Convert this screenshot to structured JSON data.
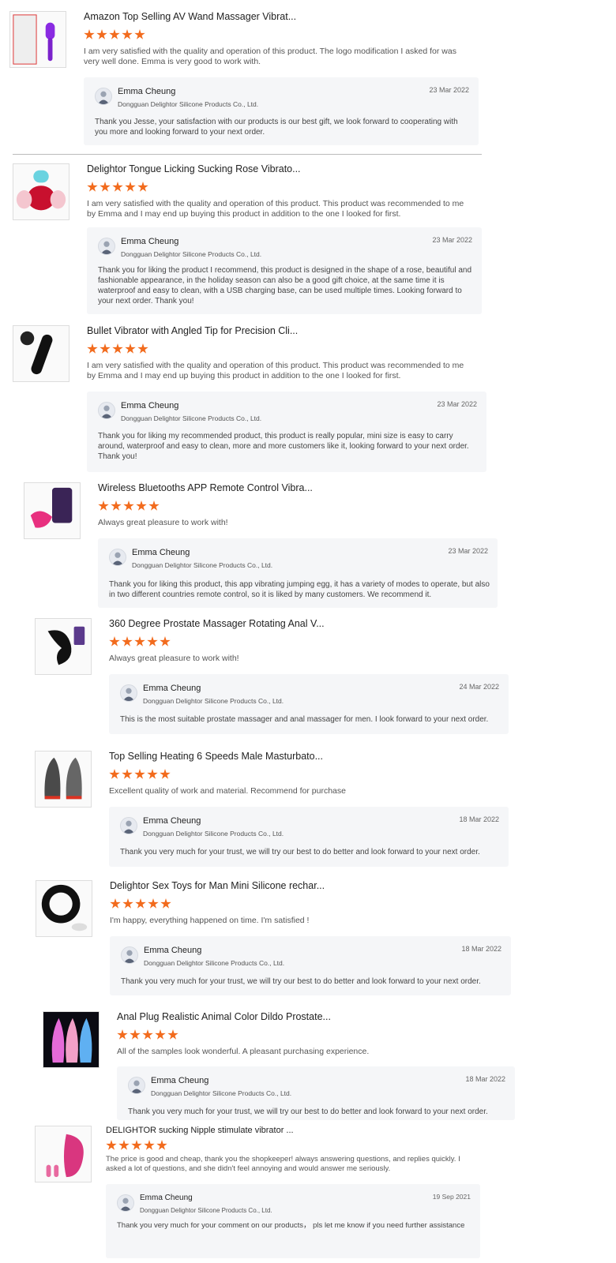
{
  "reviews": [
    {
      "title": "Amazon Top Selling AV Wand Massager Vibrat...",
      "text": "I am very satisfied with the quality and operation of this product. The logo modification I asked for was very well done.  Emma is very good to work with.",
      "rating": 5,
      "reply": {
        "name": "Emma Cheung",
        "company": "Dongguan Delightor Silicone Products Co., Ltd.",
        "date": "23 Mar 2022",
        "text": "Thank you Jesse, your satisfaction with our products is our best gift, we look forward to cooperating with you more and looking forward to your next order."
      }
    },
    {
      "title": "Delightor Tongue Licking Sucking Rose Vibrato...",
      "text": "I am very satisfied with the quality and operation of this product. This product was recommended to me by Emma and I may end up buying this product in addition to the one I looked for first.",
      "rating": 5,
      "reply": {
        "name": "Emma Cheung",
        "company": "Dongguan Delightor Silicone Products Co., Ltd.",
        "date": "23 Mar 2022",
        "text": "Thank you for liking the product I recommend, this product is designed in the shape of a rose, beautiful and fashionable appearance, in the holiday season can also be a good gift choice, at the same time it is waterproof and easy to clean, with a USB charging base, can be used multiple times. Looking forward to your next order. Thank you!"
      }
    },
    {
      "title": "Bullet Vibrator with Angled Tip for Precision Cli...",
      "text": "I am very satisfied with the quality and operation of this product. This product was recommended to me by Emma and I may end up buying this product in addition to the one I looked for first.",
      "rating": 5,
      "reply": {
        "name": "Emma Cheung",
        "company": "Dongguan Delightor Silicone Products Co., Ltd.",
        "date": "23 Mar 2022",
        "text": "Thank you for liking my recommended product, this product is really popular, mini size is easy to carry around, waterproof and easy to clean, more and more customers like it, looking forward to your next order. Thank you!"
      }
    },
    {
      "title": "Wireless Bluetooths APP Remote Control Vibra...",
      "text": "Always great pleasure to work with!",
      "rating": 5,
      "reply": {
        "name": "Emma Cheung",
        "company": "Dongguan Delightor Silicone Products Co., Ltd.",
        "date": "23 Mar 2022",
        "text": "Thank you for liking this product, this app vibrating jumping egg, it has a variety of modes to operate, but also in two different countries remote control, so it is liked by many customers. We recommend it."
      }
    },
    {
      "title": "360 Degree Prostate Massager Rotating Anal V...",
      "text": "Always great pleasure to work with!",
      "rating": 5,
      "reply": {
        "name": "Emma Cheung",
        "company": "Dongguan Delightor Silicone Products Co., Ltd.",
        "date": "24 Mar 2022",
        "text": "This is the most suitable prostate massager and anal massager for men. I look forward to your next order."
      }
    },
    {
      "title": "Top Selling Heating 6 Speeds Male Masturbato...",
      "text": "Excellent quality of work and material.  Recommend for purchase",
      "rating": 5,
      "reply": {
        "name": "Emma Cheung",
        "company": "Dongguan Delightor Silicone Products Co., Ltd.",
        "date": "18 Mar 2022",
        "text": "Thank you very much for your trust, we will try our best to do better and look forward to your next order."
      }
    },
    {
      "title": "Delightor Sex Toys for Man Mini Silicone rechar...",
      "text": "I'm happy, everything happened on time. I'm satisfied !",
      "rating": 5,
      "reply": {
        "name": "Emma Cheung",
        "company": "Dongguan Delightor Silicone Products Co., Ltd.",
        "date": "18 Mar 2022",
        "text": "Thank you very much for your trust, we will try our best to do better and look forward to your next order."
      }
    },
    {
      "title": "Anal Plug Realistic Animal Color Dildo Prostate...",
      "text": "All of the samples look wonderful. A pleasant  purchasing experience.",
      "rating": 5,
      "reply": {
        "name": "Emma Cheung",
        "company": "Dongguan Delightor Silicone Products Co., Ltd.",
        "date": "18 Mar 2022",
        "text": "Thank you very much for your trust, we will try our best to do better and look forward to your next order."
      }
    },
    {
      "title": "DELIGHTOR sucking Nipple stimulate vibrator ...",
      "text": "The price is good and cheap, thank you the shopkeeper! always answering questions, and replies quickly. I asked a lot of questions, and she didn't feel annoying and would answer me seriously.",
      "rating": 5,
      "reply": {
        "name": "Emma Cheung",
        "company": "Dongguan Delightor Silicone Products Co., Ltd.",
        "date": "19 Sep 2021",
        "text": "Thank you very much for your comment on our products，  pls let me know if you need further assistance"
      }
    }
  ],
  "colors": {
    "star": "#f26b1d",
    "reply_bg": "#f5f6f8"
  }
}
